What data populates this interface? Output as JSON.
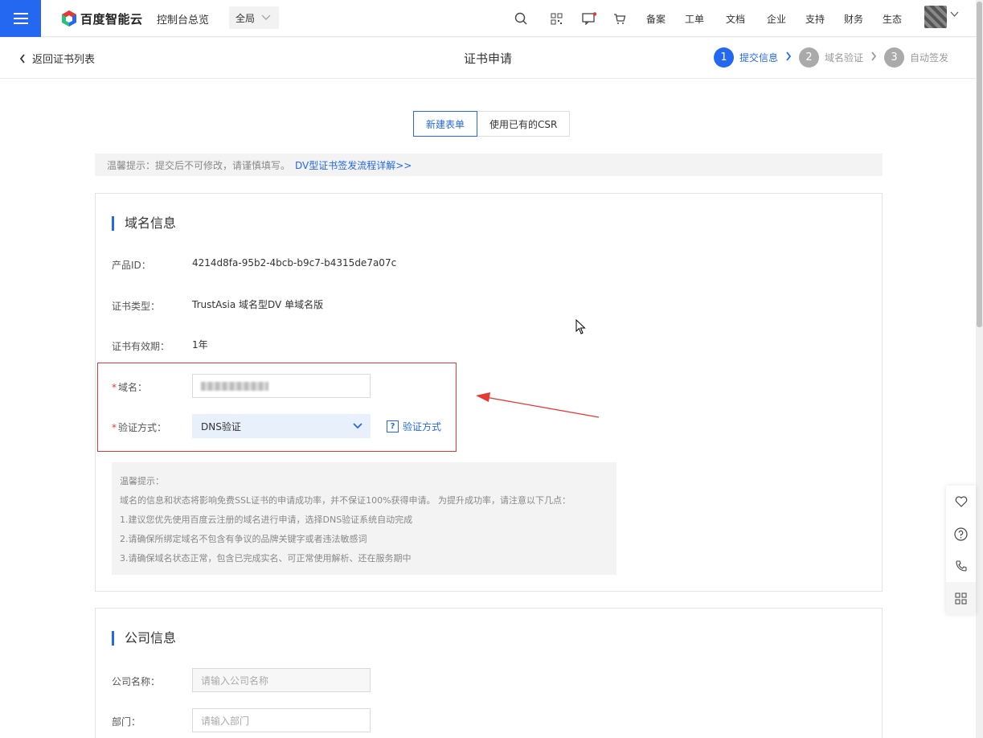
{
  "topbar": {
    "brand": "百度智能云",
    "console_overview": "控制台总览",
    "region": "全局",
    "nav_items": [
      "备案",
      "工单",
      "文档",
      "企业",
      "支持",
      "财务",
      "生态"
    ],
    "brand_colors": {
      "primary": "#2468f2",
      "red": "#e53935"
    }
  },
  "subheader": {
    "back_label": "返回证书列表",
    "title": "证书申请",
    "steps": [
      {
        "num": "1",
        "label": "提交信息",
        "active": true
      },
      {
        "num": "2",
        "label": "域名验证",
        "active": false
      },
      {
        "num": "3",
        "label": "自动签发",
        "active": false
      }
    ]
  },
  "tabs": [
    "新建表单",
    "使用已有的CSR"
  ],
  "tip": {
    "text": "温馨提示：提交后不可修改，请谨慎填写。",
    "link": "DV型证书签发流程详解>>"
  },
  "domain_section": {
    "title": "域名信息",
    "product_id_label": "产品ID：",
    "product_id": "4214d8fa-95b2-4bcb-b9c7-b4315de7a07c",
    "cert_type_label": "证书类型：",
    "cert_type": "TrustAsia 域名型DV 单域名版",
    "validity_label": "证书有效期：",
    "validity": "1年",
    "domain_label": "域名：",
    "verify_label": "验证方式：",
    "verify_value": "DNS验证",
    "verify_help": "验证方式",
    "notice_lines": [
      "温馨提示：",
      "域名的信息和状态将影响免费SSL证书的申请成功率，并不保证100%获得申请。 为提升成功率，请注意以下几点：",
      "1.建议您优先使用百度云注册的域名进行申请，选择DNS验证系统自动完成",
      "2.请确保所绑定域名不包含有争议的品牌关键字或者违法敏感词",
      "3.请确保域名状态正常，包含已完成实名、可正常使用解析、还在服务期中"
    ]
  },
  "company_section": {
    "title": "公司信息",
    "name_label": "公司名称：",
    "name_placeholder": "请输入公司名称",
    "dept_label": "部门：",
    "dept_placeholder": "请输入部门"
  }
}
